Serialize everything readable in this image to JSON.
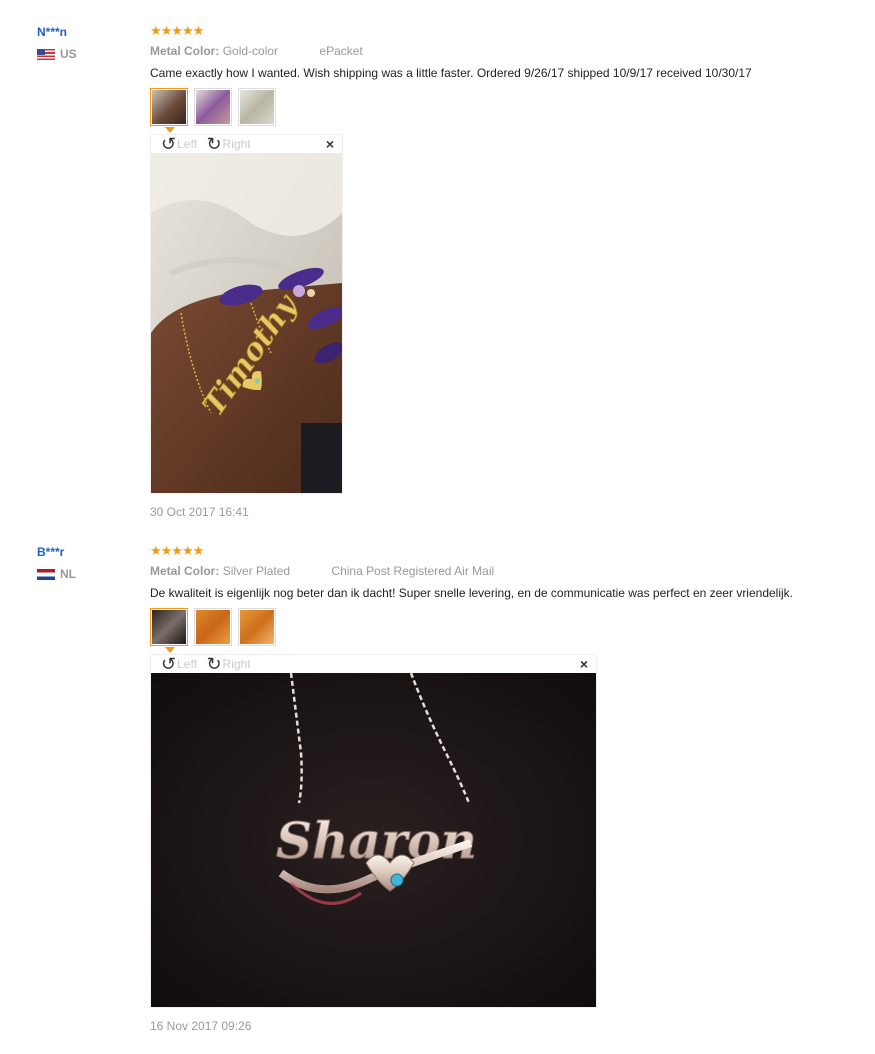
{
  "reviews": [
    {
      "user": "N***n",
      "country": "US",
      "stars": "★★★★★",
      "metal_label": "Metal Color:",
      "metal_value": "Gold-color",
      "shipping": "ePacket",
      "comment": "Came exactly how I wanted. Wish shipping was a little faster. Ordered 9/26/17 shipped 10/9/17 received 10/30/17",
      "rotate_left": "Left",
      "rotate_right": "Right",
      "photo_name": "Timothy",
      "date": "30 Oct 2017 16:41"
    },
    {
      "user": "B***r",
      "country": "NL",
      "stars": "★★★★★",
      "metal_label": "Metal Color:",
      "metal_value": "Silver Plated",
      "shipping": "China Post Registered Air Mail",
      "comment": "De kwaliteit is eigenlijk nog beter dan ik dacht! Super snelle levering, en de communicatie was perfect en zeer vriendelijk.",
      "rotate_left": "Left",
      "rotate_right": "Right",
      "photo_name": "Sharon",
      "date": "16 Nov 2017 09:26"
    }
  ],
  "icons": {
    "rotate_left": "rotate-left-icon",
    "rotate_right": "rotate-right-icon",
    "close": "close-icon"
  },
  "colors": {
    "username": "#2160c4",
    "stars": "#f29a11"
  }
}
